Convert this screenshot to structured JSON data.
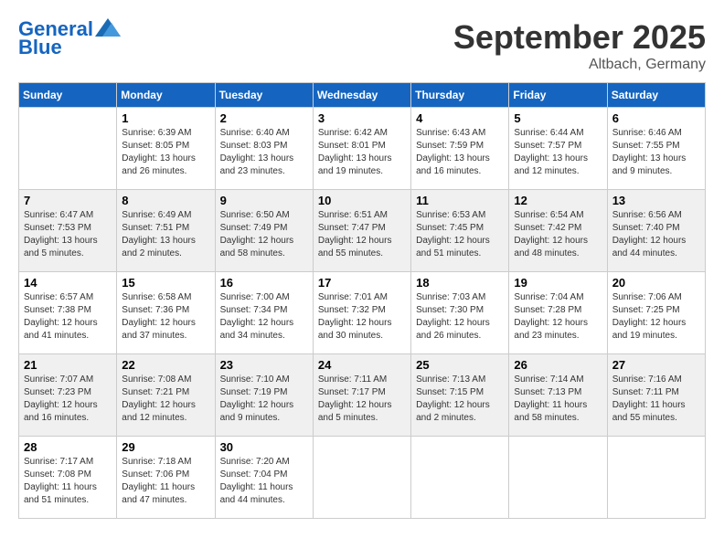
{
  "header": {
    "logo_line1": "General",
    "logo_line2": "Blue",
    "month_title": "September 2025",
    "location": "Altbach, Germany"
  },
  "days_of_week": [
    "Sunday",
    "Monday",
    "Tuesday",
    "Wednesday",
    "Thursday",
    "Friday",
    "Saturday"
  ],
  "weeks": [
    [
      {
        "day": "",
        "info": ""
      },
      {
        "day": "1",
        "info": "Sunrise: 6:39 AM\nSunset: 8:05 PM\nDaylight: 13 hours\nand 26 minutes."
      },
      {
        "day": "2",
        "info": "Sunrise: 6:40 AM\nSunset: 8:03 PM\nDaylight: 13 hours\nand 23 minutes."
      },
      {
        "day": "3",
        "info": "Sunrise: 6:42 AM\nSunset: 8:01 PM\nDaylight: 13 hours\nand 19 minutes."
      },
      {
        "day": "4",
        "info": "Sunrise: 6:43 AM\nSunset: 7:59 PM\nDaylight: 13 hours\nand 16 minutes."
      },
      {
        "day": "5",
        "info": "Sunrise: 6:44 AM\nSunset: 7:57 PM\nDaylight: 13 hours\nand 12 minutes."
      },
      {
        "day": "6",
        "info": "Sunrise: 6:46 AM\nSunset: 7:55 PM\nDaylight: 13 hours\nand 9 minutes."
      }
    ],
    [
      {
        "day": "7",
        "info": "Sunrise: 6:47 AM\nSunset: 7:53 PM\nDaylight: 13 hours\nand 5 minutes."
      },
      {
        "day": "8",
        "info": "Sunrise: 6:49 AM\nSunset: 7:51 PM\nDaylight: 13 hours\nand 2 minutes."
      },
      {
        "day": "9",
        "info": "Sunrise: 6:50 AM\nSunset: 7:49 PM\nDaylight: 12 hours\nand 58 minutes."
      },
      {
        "day": "10",
        "info": "Sunrise: 6:51 AM\nSunset: 7:47 PM\nDaylight: 12 hours\nand 55 minutes."
      },
      {
        "day": "11",
        "info": "Sunrise: 6:53 AM\nSunset: 7:45 PM\nDaylight: 12 hours\nand 51 minutes."
      },
      {
        "day": "12",
        "info": "Sunrise: 6:54 AM\nSunset: 7:42 PM\nDaylight: 12 hours\nand 48 minutes."
      },
      {
        "day": "13",
        "info": "Sunrise: 6:56 AM\nSunset: 7:40 PM\nDaylight: 12 hours\nand 44 minutes."
      }
    ],
    [
      {
        "day": "14",
        "info": "Sunrise: 6:57 AM\nSunset: 7:38 PM\nDaylight: 12 hours\nand 41 minutes."
      },
      {
        "day": "15",
        "info": "Sunrise: 6:58 AM\nSunset: 7:36 PM\nDaylight: 12 hours\nand 37 minutes."
      },
      {
        "day": "16",
        "info": "Sunrise: 7:00 AM\nSunset: 7:34 PM\nDaylight: 12 hours\nand 34 minutes."
      },
      {
        "day": "17",
        "info": "Sunrise: 7:01 AM\nSunset: 7:32 PM\nDaylight: 12 hours\nand 30 minutes."
      },
      {
        "day": "18",
        "info": "Sunrise: 7:03 AM\nSunset: 7:30 PM\nDaylight: 12 hours\nand 26 minutes."
      },
      {
        "day": "19",
        "info": "Sunrise: 7:04 AM\nSunset: 7:28 PM\nDaylight: 12 hours\nand 23 minutes."
      },
      {
        "day": "20",
        "info": "Sunrise: 7:06 AM\nSunset: 7:25 PM\nDaylight: 12 hours\nand 19 minutes."
      }
    ],
    [
      {
        "day": "21",
        "info": "Sunrise: 7:07 AM\nSunset: 7:23 PM\nDaylight: 12 hours\nand 16 minutes."
      },
      {
        "day": "22",
        "info": "Sunrise: 7:08 AM\nSunset: 7:21 PM\nDaylight: 12 hours\nand 12 minutes."
      },
      {
        "day": "23",
        "info": "Sunrise: 7:10 AM\nSunset: 7:19 PM\nDaylight: 12 hours\nand 9 minutes."
      },
      {
        "day": "24",
        "info": "Sunrise: 7:11 AM\nSunset: 7:17 PM\nDaylight: 12 hours\nand 5 minutes."
      },
      {
        "day": "25",
        "info": "Sunrise: 7:13 AM\nSunset: 7:15 PM\nDaylight: 12 hours\nand 2 minutes."
      },
      {
        "day": "26",
        "info": "Sunrise: 7:14 AM\nSunset: 7:13 PM\nDaylight: 11 hours\nand 58 minutes."
      },
      {
        "day": "27",
        "info": "Sunrise: 7:16 AM\nSunset: 7:11 PM\nDaylight: 11 hours\nand 55 minutes."
      }
    ],
    [
      {
        "day": "28",
        "info": "Sunrise: 7:17 AM\nSunset: 7:08 PM\nDaylight: 11 hours\nand 51 minutes."
      },
      {
        "day": "29",
        "info": "Sunrise: 7:18 AM\nSunset: 7:06 PM\nDaylight: 11 hours\nand 47 minutes."
      },
      {
        "day": "30",
        "info": "Sunrise: 7:20 AM\nSunset: 7:04 PM\nDaylight: 11 hours\nand 44 minutes."
      },
      {
        "day": "",
        "info": ""
      },
      {
        "day": "",
        "info": ""
      },
      {
        "day": "",
        "info": ""
      },
      {
        "day": "",
        "info": ""
      }
    ]
  ]
}
